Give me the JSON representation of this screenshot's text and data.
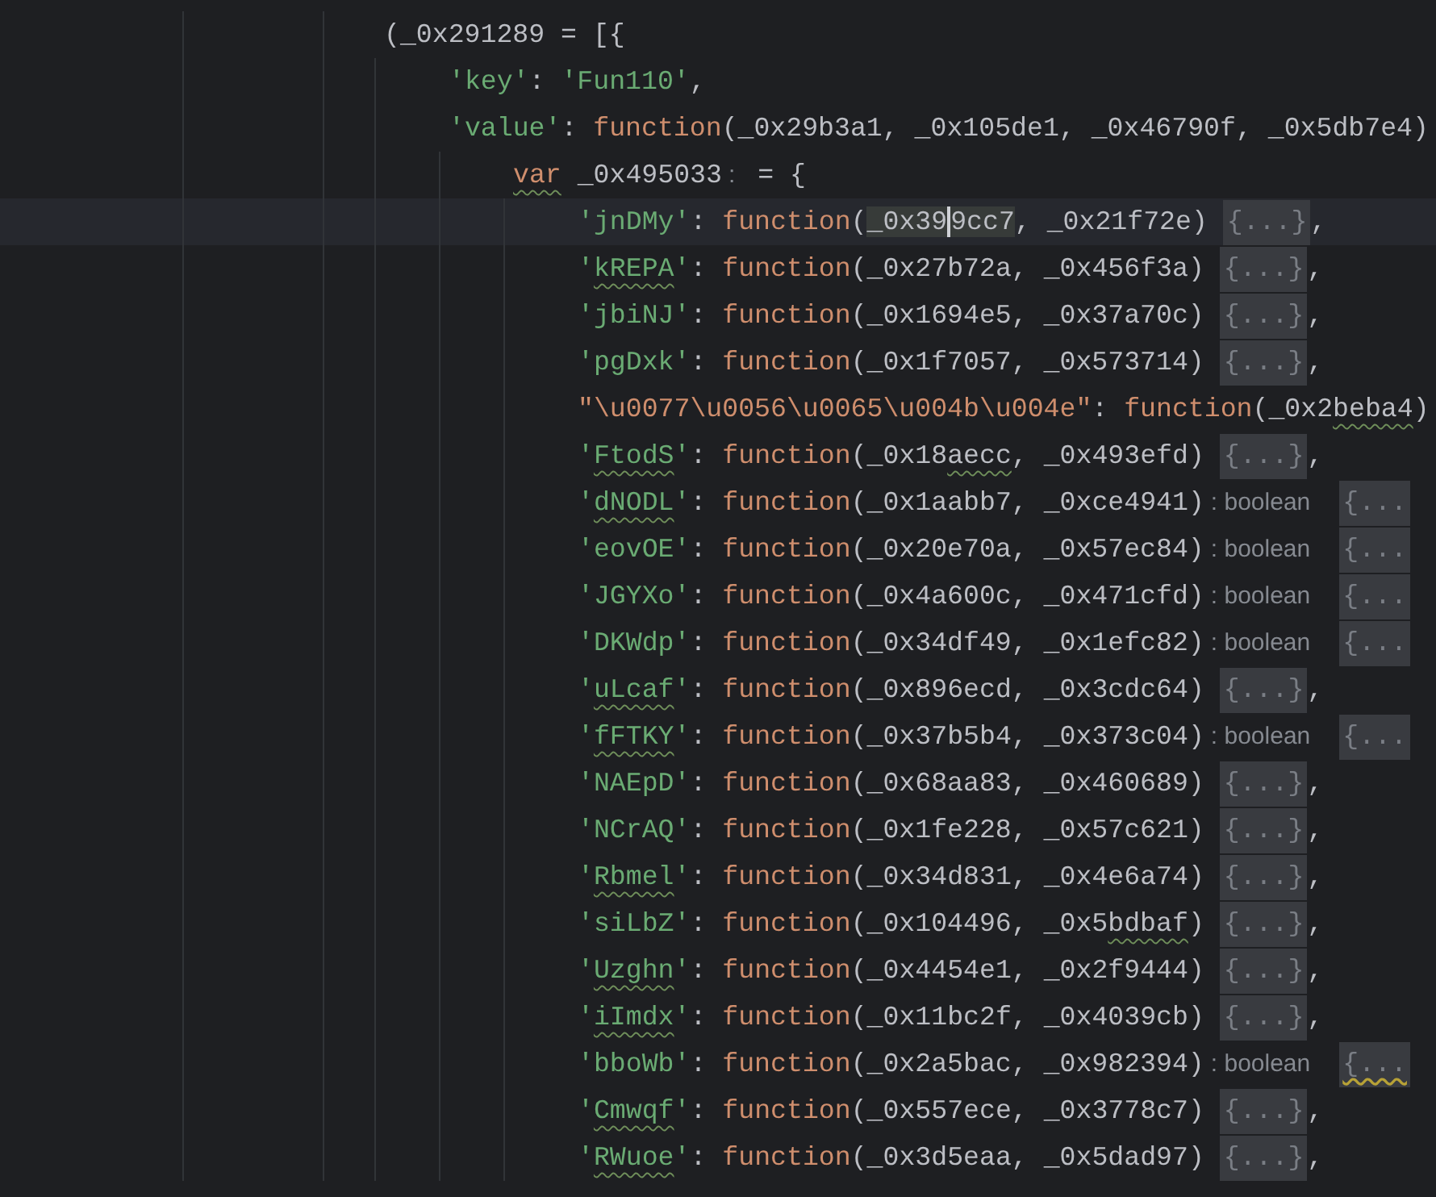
{
  "code": [
    {
      "current": false,
      "tokens": [
        {
          "kind": "plain",
          "text": "(_0x291289 = [{"
        }
      ],
      "children": [
        {
          "current": false,
          "tokens": [
            {
              "kind": "string",
              "text": "'key'"
            },
            {
              "kind": "plain",
              "text": ": "
            },
            {
              "kind": "string",
              "text": "'Fun110'"
            },
            {
              "kind": "plain",
              "text": ","
            }
          ]
        },
        {
          "current": false,
          "tokens": [
            {
              "kind": "string",
              "text": "'value'"
            },
            {
              "kind": "plain",
              "text": ": "
            },
            {
              "kind": "keyword",
              "text": "function"
            },
            {
              "kind": "plain",
              "text": "(_0x29b3a1, _0x105de1, _0x46790f, _0x5db7e4)"
            }
          ],
          "children": [
            {
              "current": false,
              "tokens": [
                {
                  "kind": "keyword_typo",
                  "text": "var"
                },
                {
                  "kind": "plain",
                  "text": " _0x495033"
                },
                {
                  "kind": "hint",
                  "text": ":"
                },
                {
                  "kind": "plain",
                  "text": " = {"
                }
              ],
              "children": [
                {
                  "current": true,
                  "tokens": [
                    {
                      "kind": "string",
                      "text": "'jnDMy'"
                    },
                    {
                      "kind": "plain",
                      "text": ": "
                    },
                    {
                      "kind": "keyword",
                      "text": "function"
                    },
                    {
                      "kind": "plain",
                      "text": "("
                    },
                    {
                      "kind": "match",
                      "text": "_0x39"
                    },
                    {
                      "kind": "match_caret",
                      "text": "9cc7"
                    },
                    {
                      "kind": "plain",
                      "text": ", _0x21f72e) "
                    },
                    {
                      "kind": "fold",
                      "text": "{...}"
                    },
                    {
                      "kind": "plain",
                      "text": ","
                    }
                  ]
                },
                {
                  "current": false,
                  "tokens": [
                    {
                      "kind": "string",
                      "text": "'"
                    },
                    {
                      "kind": "string_typo",
                      "text": "kREPA"
                    },
                    {
                      "kind": "string",
                      "text": "'"
                    },
                    {
                      "kind": "plain",
                      "text": ": "
                    },
                    {
                      "kind": "keyword",
                      "text": "function"
                    },
                    {
                      "kind": "plain",
                      "text": "(_0x27b72a, _0x456f3a) "
                    },
                    {
                      "kind": "fold",
                      "text": "{...}"
                    },
                    {
                      "kind": "plain",
                      "text": ","
                    }
                  ]
                },
                {
                  "current": false,
                  "tokens": [
                    {
                      "kind": "string",
                      "text": "'jbiNJ'"
                    },
                    {
                      "kind": "plain",
                      "text": ": "
                    },
                    {
                      "kind": "keyword",
                      "text": "function"
                    },
                    {
                      "kind": "plain",
                      "text": "(_0x1694e5, _0x37a70c) "
                    },
                    {
                      "kind": "fold",
                      "text": "{...}"
                    },
                    {
                      "kind": "plain",
                      "text": ","
                    }
                  ]
                },
                {
                  "current": false,
                  "tokens": [
                    {
                      "kind": "string",
                      "text": "'pgDxk'"
                    },
                    {
                      "kind": "plain",
                      "text": ": "
                    },
                    {
                      "kind": "keyword",
                      "text": "function"
                    },
                    {
                      "kind": "plain",
                      "text": "(_0x1f7057, _0x573714) "
                    },
                    {
                      "kind": "fold",
                      "text": "{...}"
                    },
                    {
                      "kind": "plain",
                      "text": ","
                    }
                  ]
                },
                {
                  "current": false,
                  "tokens": [
                    {
                      "kind": "escape",
                      "text": "\"\\u0077\\u0056\\u0065\\u004b\\u004e\""
                    },
                    {
                      "kind": "plain",
                      "text": ": "
                    },
                    {
                      "kind": "keyword",
                      "text": "function"
                    },
                    {
                      "kind": "plain",
                      "text": "(_0x2"
                    },
                    {
                      "kind": "plain_typo",
                      "text": "beba4"
                    },
                    {
                      "kind": "plain",
                      "text": ")"
                    }
                  ]
                },
                {
                  "current": false,
                  "tokens": [
                    {
                      "kind": "string",
                      "text": "'"
                    },
                    {
                      "kind": "string_typo",
                      "text": "FtodS"
                    },
                    {
                      "kind": "string",
                      "text": "'"
                    },
                    {
                      "kind": "plain",
                      "text": ": "
                    },
                    {
                      "kind": "keyword",
                      "text": "function"
                    },
                    {
                      "kind": "plain",
                      "text": "(_0x18"
                    },
                    {
                      "kind": "plain_typo",
                      "text": "aecc"
                    },
                    {
                      "kind": "plain",
                      "text": ", _0x493efd) "
                    },
                    {
                      "kind": "fold",
                      "text": "{...}"
                    },
                    {
                      "kind": "plain",
                      "text": ","
                    }
                  ]
                },
                {
                  "current": false,
                  "tokens": [
                    {
                      "kind": "string",
                      "text": "'"
                    },
                    {
                      "kind": "string_typo",
                      "text": "dNODL"
                    },
                    {
                      "kind": "string",
                      "text": "'"
                    },
                    {
                      "kind": "plain",
                      "text": ": "
                    },
                    {
                      "kind": "keyword",
                      "text": "function"
                    },
                    {
                      "kind": "plain",
                      "text": "(_0x1aabb7, _0xce4941)"
                    },
                    {
                      "kind": "hint",
                      "text": ": boolean"
                    },
                    {
                      "kind": "fold",
                      "text": "{..."
                    }
                  ]
                },
                {
                  "current": false,
                  "tokens": [
                    {
                      "kind": "string",
                      "text": "'eovOE'"
                    },
                    {
                      "kind": "plain",
                      "text": ": "
                    },
                    {
                      "kind": "keyword",
                      "text": "function"
                    },
                    {
                      "kind": "plain",
                      "text": "(_0x20e70a, _0x57ec84)"
                    },
                    {
                      "kind": "hint",
                      "text": ": boolean"
                    },
                    {
                      "kind": "fold",
                      "text": "{..."
                    }
                  ]
                },
                {
                  "current": false,
                  "tokens": [
                    {
                      "kind": "string",
                      "text": "'JGYXo'"
                    },
                    {
                      "kind": "plain",
                      "text": ": "
                    },
                    {
                      "kind": "keyword",
                      "text": "function"
                    },
                    {
                      "kind": "plain",
                      "text": "(_0x4a600c, _0x471cfd)"
                    },
                    {
                      "kind": "hint",
                      "text": ": boolean"
                    },
                    {
                      "kind": "fold",
                      "text": "{..."
                    }
                  ]
                },
                {
                  "current": false,
                  "tokens": [
                    {
                      "kind": "string",
                      "text": "'DKWdp'"
                    },
                    {
                      "kind": "plain",
                      "text": ": "
                    },
                    {
                      "kind": "keyword",
                      "text": "function"
                    },
                    {
                      "kind": "plain",
                      "text": "(_0x34df49, _0x1efc82)"
                    },
                    {
                      "kind": "hint",
                      "text": ": boolean"
                    },
                    {
                      "kind": "fold",
                      "text": "{..."
                    }
                  ]
                },
                {
                  "current": false,
                  "tokens": [
                    {
                      "kind": "string",
                      "text": "'"
                    },
                    {
                      "kind": "string_typo",
                      "text": "uLcaf"
                    },
                    {
                      "kind": "string",
                      "text": "'"
                    },
                    {
                      "kind": "plain",
                      "text": ": "
                    },
                    {
                      "kind": "keyword",
                      "text": "function"
                    },
                    {
                      "kind": "plain",
                      "text": "(_0x896ecd, _0x3cdc64) "
                    },
                    {
                      "kind": "fold",
                      "text": "{...}"
                    },
                    {
                      "kind": "plain",
                      "text": ","
                    }
                  ]
                },
                {
                  "current": false,
                  "tokens": [
                    {
                      "kind": "string",
                      "text": "'"
                    },
                    {
                      "kind": "string_typo",
                      "text": "fFTKY"
                    },
                    {
                      "kind": "string",
                      "text": "'"
                    },
                    {
                      "kind": "plain",
                      "text": ": "
                    },
                    {
                      "kind": "keyword",
                      "text": "function"
                    },
                    {
                      "kind": "plain",
                      "text": "(_0x37b5b4, _0x373c04)"
                    },
                    {
                      "kind": "hint",
                      "text": ": boolean"
                    },
                    {
                      "kind": "fold",
                      "text": "{..."
                    }
                  ]
                },
                {
                  "current": false,
                  "tokens": [
                    {
                      "kind": "string",
                      "text": "'NAEpD'"
                    },
                    {
                      "kind": "plain",
                      "text": ": "
                    },
                    {
                      "kind": "keyword",
                      "text": "function"
                    },
                    {
                      "kind": "plain",
                      "text": "(_0x68aa83, _0x460689) "
                    },
                    {
                      "kind": "fold",
                      "text": "{...}"
                    },
                    {
                      "kind": "plain",
                      "text": ","
                    }
                  ]
                },
                {
                  "current": false,
                  "tokens": [
                    {
                      "kind": "string",
                      "text": "'NCrAQ'"
                    },
                    {
                      "kind": "plain",
                      "text": ": "
                    },
                    {
                      "kind": "keyword",
                      "text": "function"
                    },
                    {
                      "kind": "plain",
                      "text": "(_0x1fe228, _0x57c621) "
                    },
                    {
                      "kind": "fold",
                      "text": "{...}"
                    },
                    {
                      "kind": "plain",
                      "text": ","
                    }
                  ]
                },
                {
                  "current": false,
                  "tokens": [
                    {
                      "kind": "string",
                      "text": "'"
                    },
                    {
                      "kind": "string_typo",
                      "text": "Rbmel"
                    },
                    {
                      "kind": "string",
                      "text": "'"
                    },
                    {
                      "kind": "plain",
                      "text": ": "
                    },
                    {
                      "kind": "keyword",
                      "text": "function"
                    },
                    {
                      "kind": "plain",
                      "text": "(_0x34d831, _0x4e6a74) "
                    },
                    {
                      "kind": "fold",
                      "text": "{...}"
                    },
                    {
                      "kind": "plain",
                      "text": ","
                    }
                  ]
                },
                {
                  "current": false,
                  "tokens": [
                    {
                      "kind": "string",
                      "text": "'siLbZ'"
                    },
                    {
                      "kind": "plain",
                      "text": ": "
                    },
                    {
                      "kind": "keyword",
                      "text": "function"
                    },
                    {
                      "kind": "plain",
                      "text": "(_0x104496, _0x5"
                    },
                    {
                      "kind": "plain_typo",
                      "text": "bdbaf"
                    },
                    {
                      "kind": "plain",
                      "text": ") "
                    },
                    {
                      "kind": "fold",
                      "text": "{...}"
                    },
                    {
                      "kind": "plain",
                      "text": ","
                    }
                  ]
                },
                {
                  "current": false,
                  "tokens": [
                    {
                      "kind": "string",
                      "text": "'"
                    },
                    {
                      "kind": "string_typo",
                      "text": "Uzghn"
                    },
                    {
                      "kind": "string",
                      "text": "'"
                    },
                    {
                      "kind": "plain",
                      "text": ": "
                    },
                    {
                      "kind": "keyword",
                      "text": "function"
                    },
                    {
                      "kind": "plain",
                      "text": "(_0x4454e1, _0x2f9444) "
                    },
                    {
                      "kind": "fold",
                      "text": "{...}"
                    },
                    {
                      "kind": "plain",
                      "text": ","
                    }
                  ]
                },
                {
                  "current": false,
                  "tokens": [
                    {
                      "kind": "string",
                      "text": "'"
                    },
                    {
                      "kind": "string_typo",
                      "text": "iImdx"
                    },
                    {
                      "kind": "string",
                      "text": "'"
                    },
                    {
                      "kind": "plain",
                      "text": ": "
                    },
                    {
                      "kind": "keyword",
                      "text": "function"
                    },
                    {
                      "kind": "plain",
                      "text": "(_0x11bc2f, _0x4039cb) "
                    },
                    {
                      "kind": "fold",
                      "text": "{...}"
                    },
                    {
                      "kind": "plain",
                      "text": ","
                    }
                  ]
                },
                {
                  "current": false,
                  "tokens": [
                    {
                      "kind": "string",
                      "text": "'bboWb'"
                    },
                    {
                      "kind": "plain",
                      "text": ": "
                    },
                    {
                      "kind": "keyword",
                      "text": "function"
                    },
                    {
                      "kind": "plain",
                      "text": "(_0x2a5bac, _0x982394)"
                    },
                    {
                      "kind": "hint",
                      "text": ": boolean"
                    },
                    {
                      "kind": "fold_warn",
                      "text": "{..."
                    }
                  ]
                },
                {
                  "current": false,
                  "tokens": [
                    {
                      "kind": "string",
                      "text": "'"
                    },
                    {
                      "kind": "string_typo",
                      "text": "Cmwqf"
                    },
                    {
                      "kind": "string",
                      "text": "'"
                    },
                    {
                      "kind": "plain",
                      "text": ": "
                    },
                    {
                      "kind": "keyword",
                      "text": "function"
                    },
                    {
                      "kind": "plain",
                      "text": "(_0x557ece, _0x3778c7) "
                    },
                    {
                      "kind": "fold",
                      "text": "{...}"
                    },
                    {
                      "kind": "plain",
                      "text": ","
                    }
                  ]
                },
                {
                  "current": false,
                  "tokens": [
                    {
                      "kind": "string",
                      "text": "'"
                    },
                    {
                      "kind": "string_typo",
                      "text": "RWuoe"
                    },
                    {
                      "kind": "string",
                      "text": "'"
                    },
                    {
                      "kind": "plain",
                      "text": ": "
                    },
                    {
                      "kind": "keyword",
                      "text": "function"
                    },
                    {
                      "kind": "plain",
                      "text": "(_0x3d5eaa, _0x5dad97) "
                    },
                    {
                      "kind": "fold",
                      "text": "{...}"
                    },
                    {
                      "kind": "plain",
                      "text": ","
                    }
                  ]
                }
              ]
            }
          ]
        }
      ]
    }
  ]
}
